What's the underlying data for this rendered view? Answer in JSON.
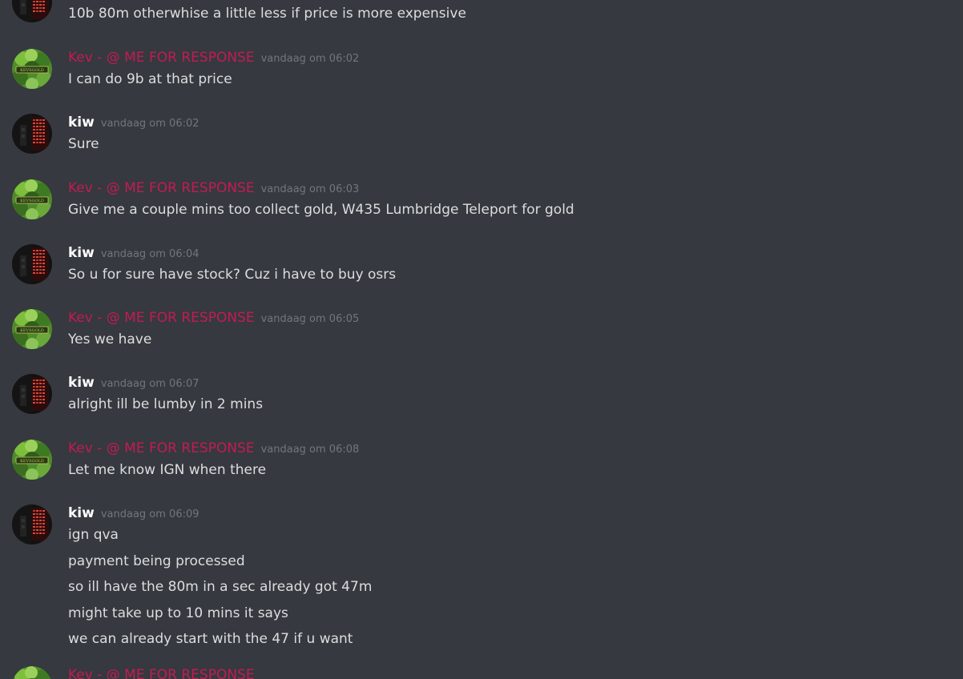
{
  "messages": {
    "m0": {
      "lines": [
        "10b 80m otherwhise a little less if price is more expensive"
      ]
    },
    "m1": {
      "username": "Kev - @ ME FOR RESPONSE",
      "timestamp": "vandaag om 06:02",
      "lines": [
        "I can do 9b at that price"
      ]
    },
    "m2": {
      "username": "kiw",
      "timestamp": "vandaag om 06:02",
      "lines": [
        "Sure"
      ]
    },
    "m3": {
      "username": "Kev - @ ME FOR RESPONSE",
      "timestamp": "vandaag om 06:03",
      "lines": [
        "Give me a couple mins too collect gold, W435 Lumbridge Teleport for gold"
      ]
    },
    "m4": {
      "username": "kiw",
      "timestamp": "vandaag om 06:04",
      "lines": [
        "So u for sure have stock? Cuz i have to buy osrs"
      ]
    },
    "m5": {
      "username": "Kev - @ ME FOR RESPONSE",
      "timestamp": "vandaag om 06:05",
      "lines": [
        "Yes we have"
      ]
    },
    "m6": {
      "username": "kiw",
      "timestamp": "vandaag om 06:07",
      "lines": [
        "alright ill be lumby in 2 mins"
      ]
    },
    "m7": {
      "username": "Kev - @ ME FOR RESPONSE",
      "timestamp": "vandaag om 06:08",
      "lines": [
        "Let me know IGN when there"
      ]
    },
    "m8": {
      "username": "kiw",
      "timestamp": "vandaag om 06:09",
      "lines": [
        "ign qva",
        "payment being processed",
        "so ill have the 80m in a sec already got 47m",
        "might take up to 10 mins it says",
        "we can already start with the 47 if u want"
      ]
    },
    "m9": {
      "username": "Kev - @ ME FOR RESPONSE"
    }
  },
  "avatars": {
    "kev": {
      "logo_text": "KEVSGOLD"
    }
  },
  "colors": {
    "background": "#36393f",
    "kev_name": "#c31b52",
    "kiw_name": "#ffffff",
    "timestamp": "#72767d",
    "message_text": "#dcddde"
  }
}
